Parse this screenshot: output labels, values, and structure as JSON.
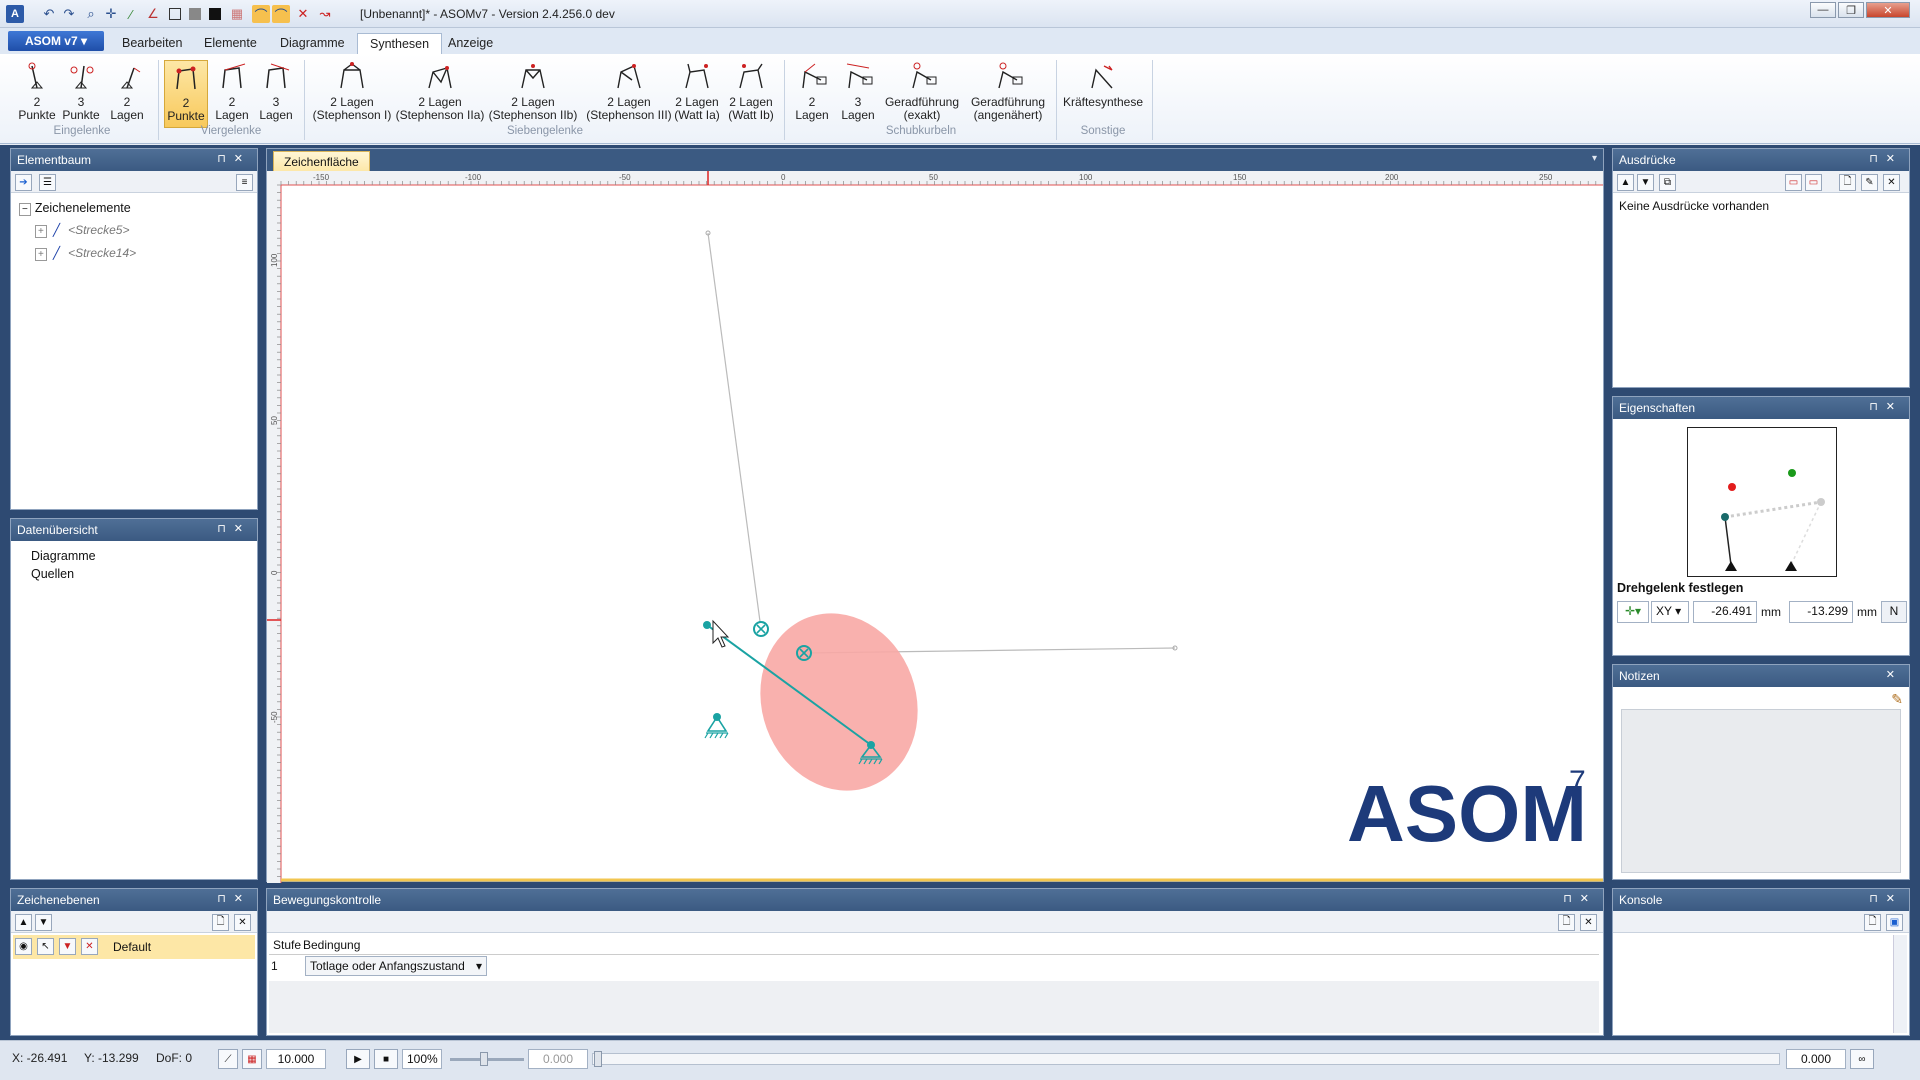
{
  "window": {
    "title": "[Unbenannt]* - ASOMv7 - Version 2.4.256.0 dev"
  },
  "tabs": {
    "app": "ASOM v7 ▾",
    "bearbeiten": "Bearbeiten",
    "elemente": "Elemente",
    "diagramme": "Diagramme",
    "synthesen": "Synthesen",
    "anzeige": "Anzeige"
  },
  "ribbon": {
    "eingelenke": {
      "label": "Eingelenke",
      "b1": "2\nPunkte",
      "b2": "3\nPunkte",
      "b3": "2\nLagen"
    },
    "viergelenke": {
      "label": "Viergelenke",
      "b1": "2\nPunkte",
      "b2": "2\nLagen",
      "b3": "3\nLagen"
    },
    "siebengelenke": {
      "label": "Siebengelenke",
      "b1": "2 Lagen\n(Stephenson I)",
      "b2": "2 Lagen\n(Stephenson IIa)",
      "b3": "2 Lagen\n(Stephenson IIb)",
      "b4": "2 Lagen\n(Stephenson III)",
      "b5": "2 Lagen\n(Watt Ia)",
      "b6": "2 Lagen\n(Watt Ib)"
    },
    "schubkurbeln": {
      "label": "Schubkurbeln",
      "b1": "2\nLagen",
      "b2": "3\nLagen",
      "b3": "Geradführung\n(exakt)",
      "b4": "Geradführung\n(angenähert)"
    },
    "sonstige": {
      "label": "Sonstige",
      "b1": "Kräftesynthese"
    }
  },
  "elementbaum": {
    "title": "Elementbaum",
    "root": "Zeichenelemente",
    "items": [
      "<Strecke5>",
      "<Strecke14>"
    ]
  },
  "datenuebersicht": {
    "title": "Datenübersicht",
    "items": [
      "Diagramme",
      "Quellen"
    ]
  },
  "zeichenflaeche": {
    "tab": "Zeichenfläche",
    "ruler_top": [
      "-150",
      "-100",
      "-50",
      "0",
      "50",
      "100",
      "150",
      "200",
      "250"
    ],
    "ruler_left": [
      "100",
      "50",
      "0",
      "-50"
    ]
  },
  "logo": {
    "text": "ASOM",
    "sup": "7"
  },
  "ausdruecke": {
    "title": "Ausdrücke",
    "empty": "Keine Ausdrücke vorhanden"
  },
  "eigenschaften": {
    "title": "Eigenschaften",
    "heading": "Drehgelenk festlegen",
    "mode": "XY",
    "x": "-26.491",
    "y": "-13.299",
    "unit": "mm",
    "n_btn": "N"
  },
  "notizen": {
    "title": "Notizen"
  },
  "zeichenebenen": {
    "title": "Zeichenebenen",
    "layer": "Default"
  },
  "bewegung": {
    "title": "Bewegungskontrolle",
    "col1": "Stufe",
    "col2": "Bedingung",
    "row_stufe": "1",
    "row_bedingung": "Totlage oder Anfangszustand"
  },
  "konsole": {
    "title": "Konsole"
  },
  "status": {
    "x": "X: -26.491",
    "y": "Y: -13.299",
    "dof": "DoF: 0",
    "grid": "10.000",
    "zoom": "100%",
    "time": "0.000",
    "value": "0.000"
  }
}
